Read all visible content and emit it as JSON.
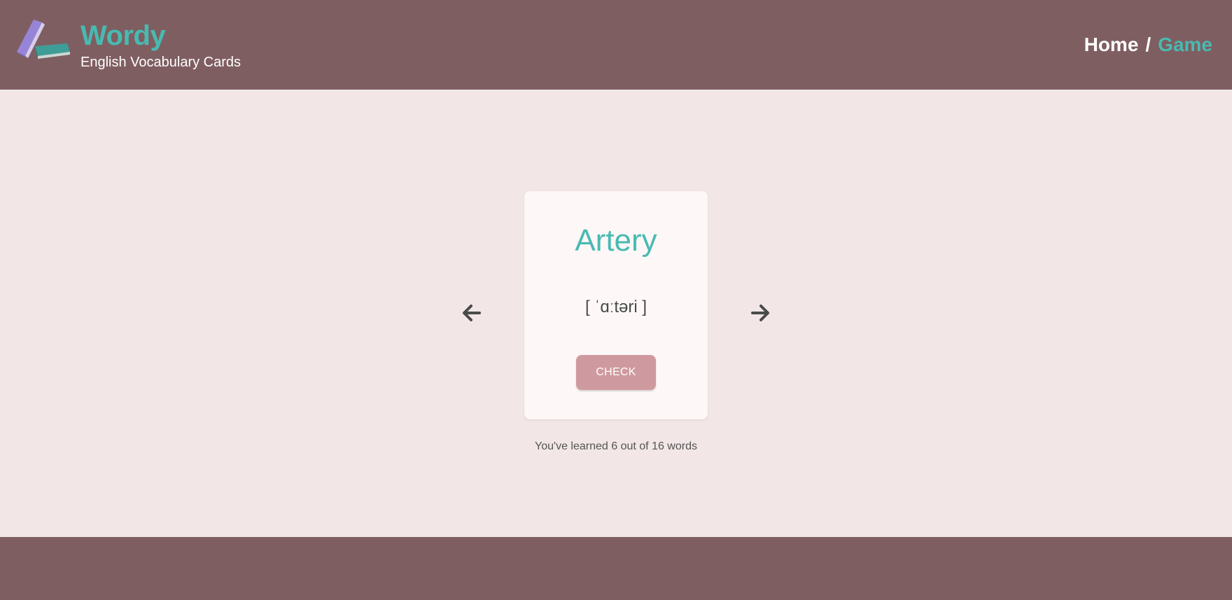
{
  "header": {
    "title": "Wordy",
    "subtitle": "English Vocabulary Cards",
    "logo_icon": "books-icon",
    "nav": {
      "home": "Home",
      "separator": "/",
      "game": "Game"
    }
  },
  "card": {
    "word": "Artery",
    "transcription": "[ ˈɑːtəri ]",
    "check_label": "CHECK"
  },
  "navigation": {
    "prev_icon": "arrow-left-icon",
    "next_icon": "arrow-right-icon"
  },
  "progress": {
    "text": "You've learned 6 out of 16 words",
    "learned": 6,
    "total": 16
  },
  "colors": {
    "header_bg": "#7f5e61",
    "accent": "#48bab1",
    "page_bg": "#f2e6e6",
    "card_bg": "#fdf7f7",
    "button_bg": "#cf9a9f"
  }
}
